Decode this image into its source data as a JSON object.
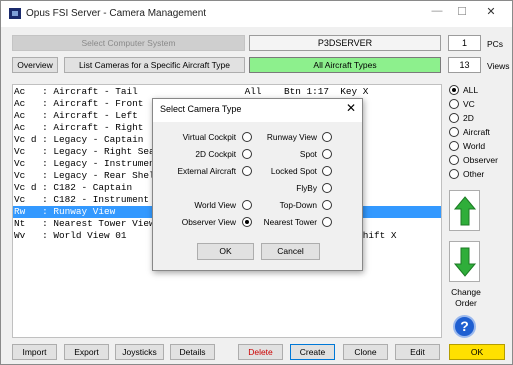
{
  "window": {
    "title": "Opus FSI Server - Camera Management",
    "min": "—",
    "max": "☐",
    "close": "✕"
  },
  "top": {
    "select_computer": "Select Computer System",
    "server": "P3DSERVER",
    "pcs_count": "1",
    "pcs_label": "PCs",
    "overview": "Overview",
    "list_specific": "List Cameras for a Specific Aircraft Type",
    "all_aircraft": "All Aircraft Types",
    "views_count": "13",
    "views_label": "Views"
  },
  "list": [
    "Ac   : Aircraft - Tail                   All    Btn 1:17  Key X",
    "Ac   : Aircraft - Front",
    "Ac   : Aircraft - Left",
    "Ac   : Aircraft - Right",
    "Vc d : Legacy - Captain",
    "Vc   : Legacy - Right Seat",
    "Vc   : Legacy - Instrument",
    "Vc   : Legacy - Rear Shelf",
    "Vc d : C182 - Captain",
    "Vc   : C182 - Instrument P",
    "Rw   : Runway View",
    "Nt   : Nearest Tower View",
    "Wv   : World View 01                                      rl Shift X"
  ],
  "filters": [
    "ALL",
    "VC",
    "2D",
    "Aircraft",
    "World",
    "Observer",
    "Other"
  ],
  "side": {
    "change_order": "Change Order",
    "help": "?"
  },
  "bottom": {
    "import": "Import",
    "export": "Export",
    "joysticks": "Joysticks",
    "details": "Details",
    "delete": "Delete",
    "create": "Create",
    "clone": "Clone",
    "edit": "Edit",
    "ok": "OK"
  },
  "dialog": {
    "title": "Select Camera Type",
    "close": "✕",
    "left": [
      "Virtual Cockpit",
      "2D Cockpit",
      "External Aircraft",
      "World View",
      "Observer View"
    ],
    "right": [
      "Runway View",
      "Spot",
      "Locked Spot",
      "FlyBy",
      "Top-Down",
      "Nearest Tower"
    ],
    "ok": "OK",
    "cancel": "Cancel"
  },
  "colors": {
    "accent": "#3399ff",
    "green": "#8df08d",
    "yellow": "#ffe000",
    "delete_text": "#cc0000"
  }
}
